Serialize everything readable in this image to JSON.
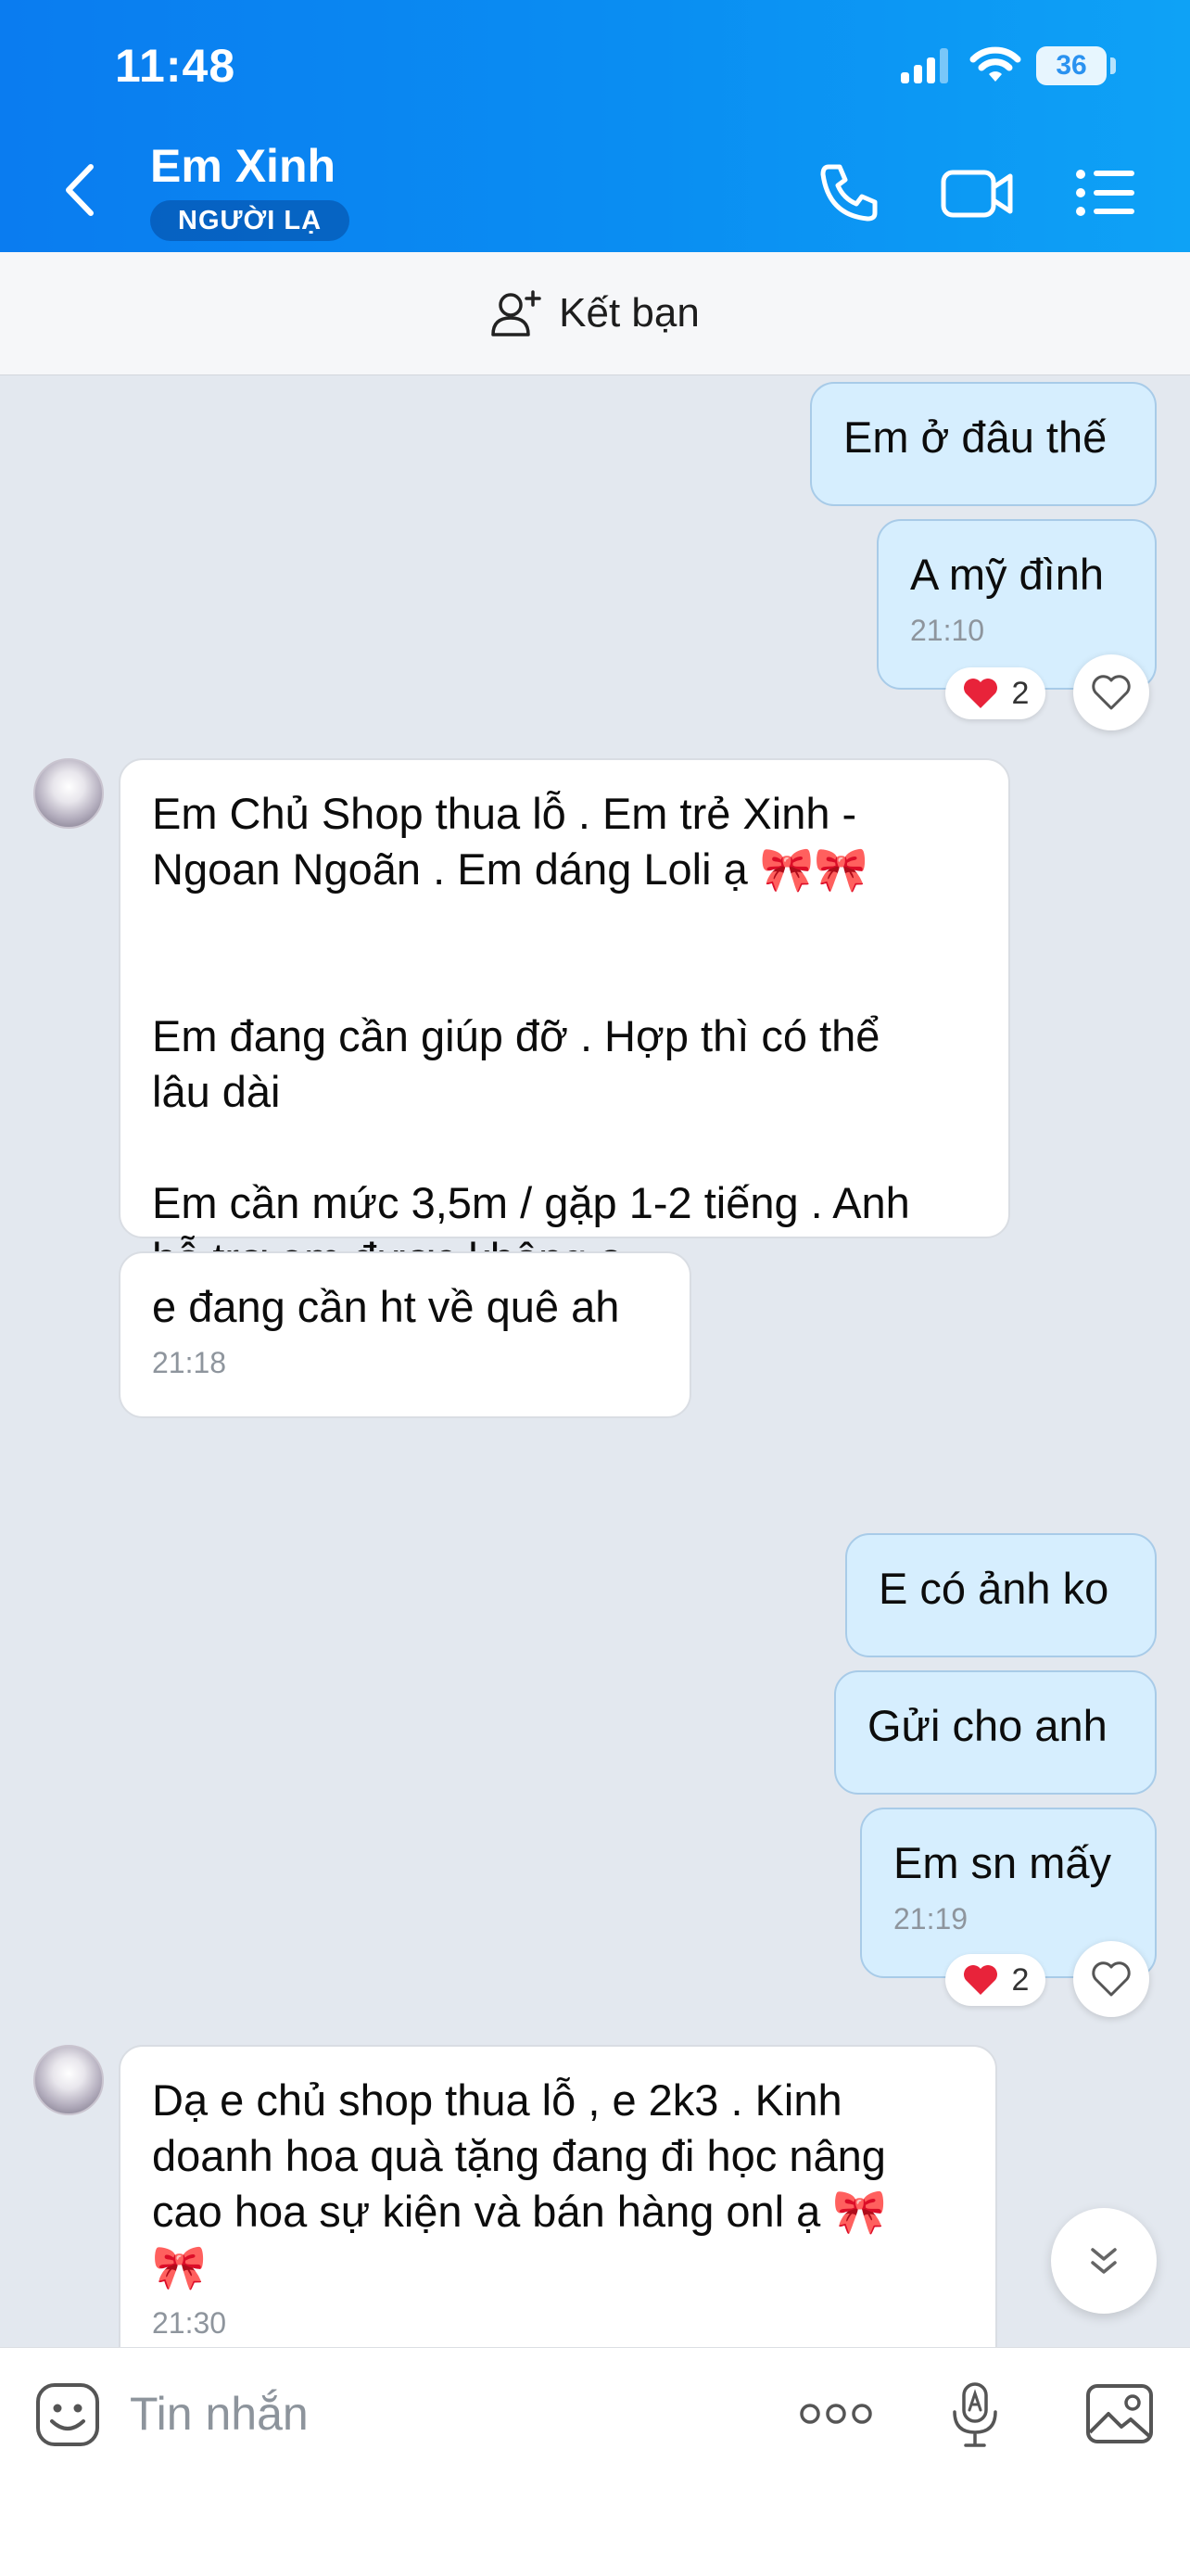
{
  "status_bar": {
    "time": "11:48",
    "battery": "36"
  },
  "header": {
    "contact_name": "Em Xinh",
    "badge": "NGƯỜI LẠ",
    "icons": [
      "back-chevron",
      "phone",
      "video-camera",
      "list-menu"
    ]
  },
  "add_friend": {
    "label": "Kết bạn",
    "icon": "person-plus"
  },
  "messages": [
    {
      "dir": "out",
      "text": "Em ở đâu thế",
      "time": ""
    },
    {
      "dir": "out",
      "text": "A mỹ đình",
      "time": "21:10",
      "reaction": {
        "emoji": "❤️",
        "count": "2"
      }
    },
    {
      "dir": "in",
      "text": "Em Chủ Shop thua lỗ . Em trẻ Xinh -\nNgoan Ngoãn . Em dáng Loli ạ 🎀🎀\n\n\nEm đang cần giúp đỡ . Hợp thì có thể\nlâu dài\n\nEm cần mức 3,5m / gặp 1-2 tiếng . Anh\nhỗ trợ em được không ạ",
      "time": ""
    },
    {
      "dir": "in",
      "text": "e đang cần ht về quê ah",
      "time": "21:18"
    },
    {
      "dir": "out",
      "text": "E có ảnh ko",
      "time": ""
    },
    {
      "dir": "out",
      "text": "Gửi cho anh",
      "time": ""
    },
    {
      "dir": "out",
      "text": "Em sn mấy",
      "time": "21:19",
      "reaction": {
        "emoji": "❤️",
        "count": "2"
      }
    },
    {
      "dir": "in",
      "text": "Dạ e chủ shop thua lỗ , e 2k3 . Kinh\ndoanh hoa quà tặng đang đi học nâng\ncao hoa sự kiện và bán hàng onl ạ 🎀\n🎀",
      "time": "21:30"
    }
  ],
  "input": {
    "placeholder": "Tin nhắn",
    "icons": [
      "sticker",
      "more",
      "voice",
      "image"
    ]
  },
  "colors": {
    "header_start": "#0a7cf0",
    "header_end": "#0ea2f6",
    "outgoing_bubble": "#d6eefe",
    "incoming_bubble": "#ffffff",
    "chat_bg": "#e3e8ef",
    "reaction_heart": "#e8233a"
  }
}
